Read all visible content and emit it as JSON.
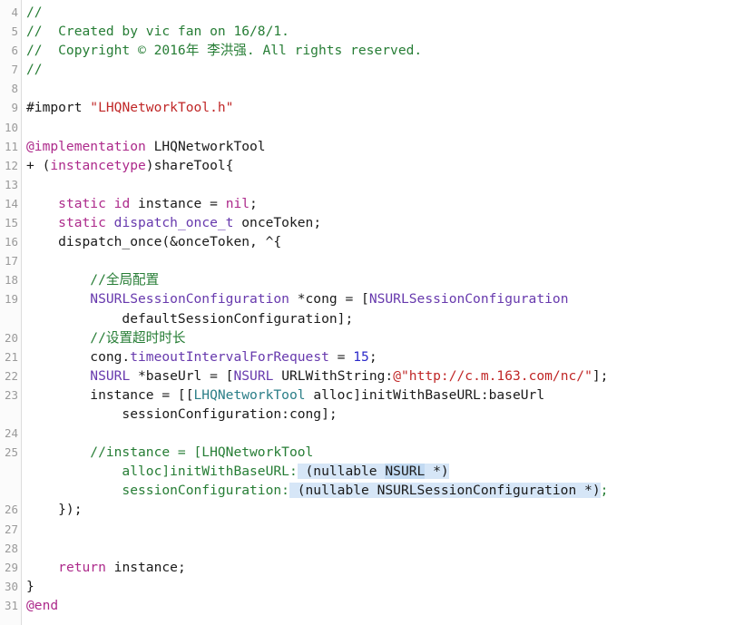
{
  "editor": {
    "language": "Objective-C",
    "first_line_number": 4,
    "last_line_number": 31,
    "colors": {
      "background": "#ffffff",
      "gutter_background": "#fbfbfb",
      "gutter_border": "#dcdcdc",
      "line_number": "#9a9a9a",
      "plain_text": "#1a1a1a",
      "comment": "#267d35",
      "keyword": "#ad2a8b",
      "type": "#6739ad",
      "class_reference": "#2a7e87",
      "string": "#c02727",
      "number": "#2b29c9",
      "property": "#6739ad",
      "selection": "#d6e6f7",
      "selection_strong": "#c2daf2"
    },
    "gutter": [
      "4",
      "5",
      "6",
      "7",
      "8",
      "9",
      "10",
      "11",
      "12",
      "13",
      "14",
      "15",
      "16",
      "17",
      "18",
      "19",
      "",
      "20",
      "21",
      "22",
      "23",
      "",
      "24",
      "25",
      "",
      "",
      "26",
      "27",
      "28",
      "29",
      "30",
      "31"
    ],
    "lines": [
      {
        "number": "4",
        "tokens": [
          {
            "text": "//",
            "style": "comment"
          }
        ]
      },
      {
        "number": "5",
        "tokens": [
          {
            "text": "//  Created by vic fan on 16/8/1.",
            "style": "comment"
          }
        ]
      },
      {
        "number": "6",
        "tokens": [
          {
            "text": "//  Copyright © 2016年 李洪强. All rights reserved.",
            "style": "comment"
          }
        ]
      },
      {
        "number": "7",
        "tokens": [
          {
            "text": "//",
            "style": "comment"
          }
        ]
      },
      {
        "number": "8",
        "tokens": []
      },
      {
        "number": "9",
        "tokens": [
          {
            "text": "#import ",
            "style": "pre"
          },
          {
            "text": "\"LHQNetworkTool.h\"",
            "style": "string"
          }
        ]
      },
      {
        "number": "10",
        "tokens": []
      },
      {
        "number": "11",
        "tokens": [
          {
            "text": "@implementation",
            "style": "keyword"
          },
          {
            "text": " LHQNetworkTool",
            "style": "plain"
          }
        ]
      },
      {
        "number": "12",
        "tokens": [
          {
            "text": "+ (",
            "style": "plain"
          },
          {
            "text": "instancetype",
            "style": "keyword"
          },
          {
            "text": ")shareTool{",
            "style": "plain"
          }
        ]
      },
      {
        "number": "13",
        "tokens": []
      },
      {
        "number": "14",
        "tokens": [
          {
            "text": "    ",
            "style": "plain"
          },
          {
            "text": "static",
            "style": "keyword"
          },
          {
            "text": " ",
            "style": "plain"
          },
          {
            "text": "id",
            "style": "keyword"
          },
          {
            "text": " instance = ",
            "style": "plain"
          },
          {
            "text": "nil",
            "style": "keyword"
          },
          {
            "text": ";",
            "style": "plain"
          }
        ]
      },
      {
        "number": "15",
        "tokens": [
          {
            "text": "    ",
            "style": "plain"
          },
          {
            "text": "static",
            "style": "keyword"
          },
          {
            "text": " ",
            "style": "plain"
          },
          {
            "text": "dispatch_once_t",
            "style": "type"
          },
          {
            "text": " onceToken;",
            "style": "plain"
          }
        ]
      },
      {
        "number": "16",
        "tokens": [
          {
            "text": "    dispatch_once(&onceToken, ^{",
            "style": "plain"
          }
        ]
      },
      {
        "number": "17",
        "tokens": []
      },
      {
        "number": "18",
        "tokens": [
          {
            "text": "        //全局配置",
            "style": "comment"
          }
        ]
      },
      {
        "number": "19",
        "tokens": [
          {
            "text": "        ",
            "style": "plain"
          },
          {
            "text": "NSURLSessionConfiguration",
            "style": "type"
          },
          {
            "text": " *cong = [",
            "style": "plain"
          },
          {
            "text": "NSURLSessionConfiguration",
            "style": "type"
          }
        ]
      },
      {
        "number": "",
        "continuation": true,
        "tokens": [
          {
            "text": "            defaultSessionConfiguration];",
            "style": "plain"
          }
        ]
      },
      {
        "number": "20",
        "tokens": [
          {
            "text": "        //设置超时时长",
            "style": "comment"
          }
        ]
      },
      {
        "number": "21",
        "tokens": [
          {
            "text": "        cong.",
            "style": "plain"
          },
          {
            "text": "timeoutIntervalForRequest",
            "style": "prop"
          },
          {
            "text": " = ",
            "style": "plain"
          },
          {
            "text": "15",
            "style": "number"
          },
          {
            "text": ";",
            "style": "plain"
          }
        ]
      },
      {
        "number": "22",
        "tokens": [
          {
            "text": "        ",
            "style": "plain"
          },
          {
            "text": "NSURL",
            "style": "type"
          },
          {
            "text": " *baseUrl = [",
            "style": "plain"
          },
          {
            "text": "NSURL",
            "style": "type"
          },
          {
            "text": " URLWithString:",
            "style": "plain"
          },
          {
            "text": "@\"http://c.m.163.com/nc/\"",
            "style": "string"
          },
          {
            "text": "];",
            "style": "plain"
          }
        ]
      },
      {
        "number": "23",
        "tokens": [
          {
            "text": "        instance = [[",
            "style": "plain"
          },
          {
            "text": "LHQNetworkTool",
            "style": "class"
          },
          {
            "text": " alloc]initWithBaseURL:baseUrl",
            "style": "plain"
          }
        ]
      },
      {
        "number": "",
        "continuation": true,
        "tokens": [
          {
            "text": "            sessionConfiguration:cong];",
            "style": "plain"
          }
        ]
      },
      {
        "number": "24",
        "tokens": []
      },
      {
        "number": "25",
        "tokens": [
          {
            "text": "        //instance = [",
            "style": "comment"
          },
          {
            "text": "LHQNetworkTool",
            "style": "comment"
          }
        ]
      },
      {
        "number": "",
        "continuation": true,
        "tokens": [
          {
            "text": "            alloc]initWithBaseURL:",
            "style": "comment"
          },
          {
            "text": " (nullable ",
            "style": "sel"
          },
          {
            "text": "NSURL",
            "style": "sel-strong"
          },
          {
            "text": " *)",
            "style": "sel"
          }
        ]
      },
      {
        "number": "",
        "continuation": true,
        "tokens": [
          {
            "text": "            sessionConfiguration:",
            "style": "comment"
          },
          {
            "text": " (nullable NSURLSessionConfiguration *)",
            "style": "sel"
          },
          {
            "text": ";",
            "style": "comment"
          }
        ]
      },
      {
        "number": "26",
        "tokens": [
          {
            "text": "    });",
            "style": "plain"
          }
        ]
      },
      {
        "number": "27",
        "tokens": []
      },
      {
        "number": "28",
        "tokens": []
      },
      {
        "number": "29",
        "tokens": [
          {
            "text": "    ",
            "style": "plain"
          },
          {
            "text": "return",
            "style": "keyword"
          },
          {
            "text": " instance;",
            "style": "plain"
          }
        ]
      },
      {
        "number": "30",
        "tokens": [
          {
            "text": "}",
            "style": "plain"
          }
        ]
      },
      {
        "number": "31",
        "tokens": [
          {
            "text": "@end",
            "style": "keyword"
          }
        ]
      }
    ]
  }
}
